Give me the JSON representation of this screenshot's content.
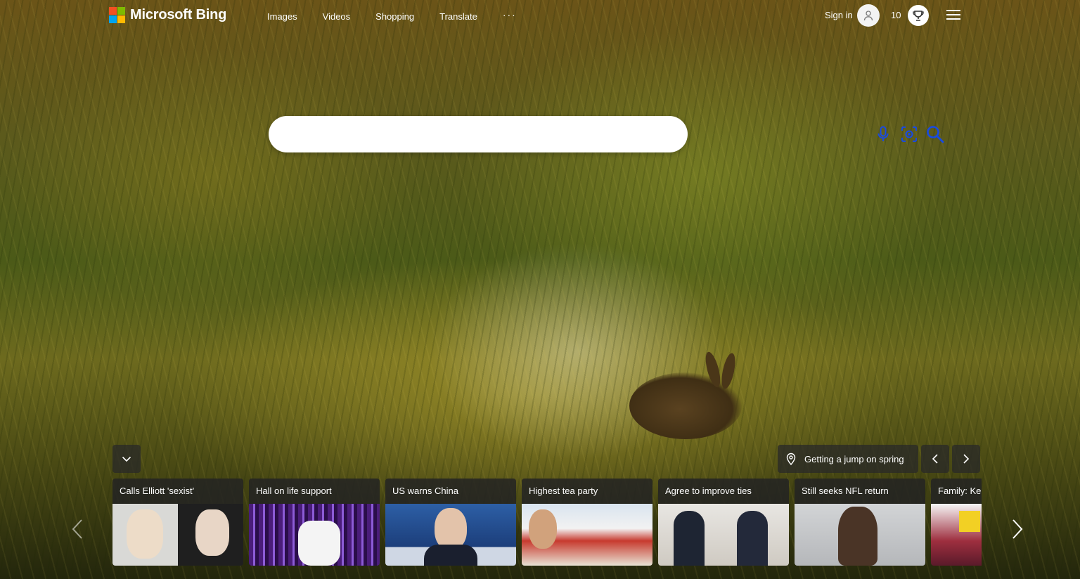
{
  "header": {
    "logo_text": "Microsoft Bing",
    "nav": [
      {
        "label": "Images"
      },
      {
        "label": "Videos"
      },
      {
        "label": "Shopping"
      },
      {
        "label": "Translate"
      },
      {
        "label": "···"
      }
    ],
    "signin_label": "Sign in",
    "rewards_points": "10"
  },
  "search": {
    "value": "",
    "placeholder": ""
  },
  "image_info": {
    "title": "Getting a jump on spring"
  },
  "news_cards": [
    {
      "title": "Calls Elliott 'sexist'"
    },
    {
      "title": "Hall on life support"
    },
    {
      "title": "US warns China"
    },
    {
      "title": "Highest tea party"
    },
    {
      "title": "Agree to improve ties"
    },
    {
      "title": "Still seeks NFL return"
    },
    {
      "title": "Family: Ke"
    }
  ],
  "colors": {
    "accent": "#174ae4",
    "logo_red": "#f25022",
    "logo_green": "#7fba00",
    "logo_blue": "#00a4ef",
    "logo_yellow": "#ffb900"
  },
  "icons": {
    "mic": "microphone-icon",
    "visual_search": "visual-search-icon",
    "search": "search-icon",
    "menu": "hamburger-menu-icon",
    "reward": "rewards-trophy-icon",
    "location": "location-pin-icon"
  }
}
